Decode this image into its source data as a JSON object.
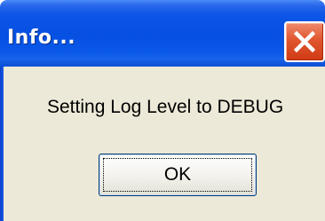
{
  "window": {
    "title": "Info...",
    "close_icon": "close-icon"
  },
  "dialog": {
    "message": "Setting Log Level to DEBUG",
    "ok_label": "OK"
  },
  "colors": {
    "titlebar": "#0650e2",
    "close_button": "#e0562e",
    "dialog_background": "#ece9d8"
  }
}
